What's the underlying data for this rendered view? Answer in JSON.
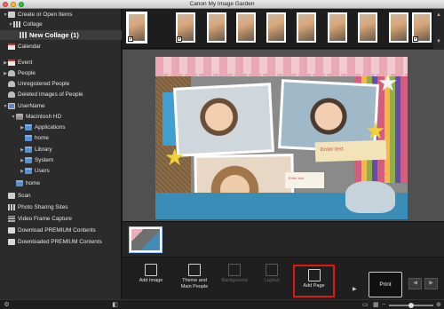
{
  "window": {
    "title": "Canon My Image Garden",
    "traffic_colors": [
      "#ff5f57",
      "#febc2e",
      "#28c840"
    ]
  },
  "sidebar": {
    "items": [
      {
        "label": "Create or Open Items"
      },
      {
        "label": "Collage"
      },
      {
        "label": "New Collage (1)"
      },
      {
        "label": "Calendar"
      },
      {
        "label": "Event"
      },
      {
        "label": "People"
      },
      {
        "label": "Unregistered People"
      },
      {
        "label": "Deleted Images of People"
      },
      {
        "label": "UserName"
      },
      {
        "label": "Macintosh HD"
      },
      {
        "label": "Applications"
      },
      {
        "label": "home"
      },
      {
        "label": "Library"
      },
      {
        "label": "System"
      },
      {
        "label": "Users"
      },
      {
        "label": "home"
      },
      {
        "label": "Scan"
      },
      {
        "label": "Photo Sharing Sites"
      },
      {
        "label": "Video Frame Capture"
      },
      {
        "label": "Download PREMIUM Contents"
      },
      {
        "label": "Downloaded PREMIUM Contents"
      }
    ]
  },
  "filmstrip": {
    "thumbnail_count": 10,
    "checked": [
      true,
      true,
      false,
      false,
      false,
      false,
      false,
      false,
      false,
      true
    ]
  },
  "collage": {
    "text_box_1": "Enter text.",
    "text_box_2": "Enter text."
  },
  "toolbar": {
    "add_image": "Add Image",
    "theme_people": "Theme and\nMain People",
    "background": "Background",
    "layout": "Layout",
    "add_page": "Add Page",
    "print": "Print"
  },
  "colors": {
    "highlight": "#e21414",
    "accent_blue": "#5a8fd0"
  }
}
